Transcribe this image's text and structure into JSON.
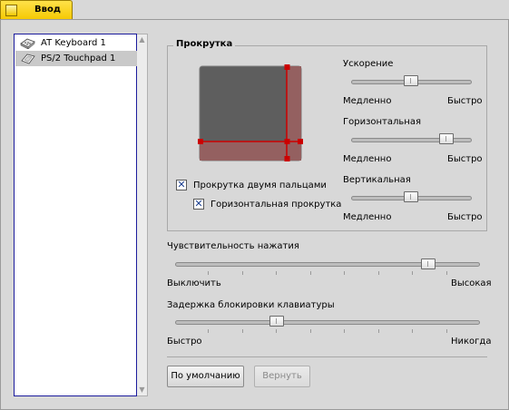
{
  "window": {
    "title": "Ввод"
  },
  "devices": [
    {
      "label": "AT Keyboard 1",
      "icon": "keyboard-icon",
      "selected": false
    },
    {
      "label": "PS/2 Touchpad 1",
      "icon": "touchpad-icon",
      "selected": true
    }
  ],
  "scroll_section": {
    "legend": "Прокрутка",
    "two_finger_label": "Прокрутка двумя пальцами",
    "two_finger_checked": true,
    "horizontal_scroll_label": "Горизонтальная прокрутка",
    "horizontal_scroll_checked": true,
    "acceleration": {
      "label": "Ускорение",
      "min_label": "Медленно",
      "max_label": "Быстро",
      "value_fraction": 0.5
    },
    "horizontal": {
      "label": "Горизонтальная",
      "min_label": "Медленно",
      "max_label": "Быстро",
      "value_fraction": 0.8
    },
    "vertical": {
      "label": "Вертикальная",
      "min_label": "Медленно",
      "max_label": "Быстро",
      "value_fraction": 0.5
    }
  },
  "sensitivity": {
    "label": "Чувствительность нажатия",
    "min_label": "Выключить",
    "max_label": "Высокая",
    "value_fraction": 0.83
  },
  "keyboard_lock_delay": {
    "label": "Задержка блокировки клавиатуры",
    "min_label": "Быстро",
    "max_label": "Никогда",
    "value_fraction": 0.33
  },
  "buttons": {
    "defaults_label": "По умолчанию",
    "revert_label": "Вернуть"
  },
  "colors": {
    "title_tab": "#f5c800",
    "list_border": "#1c1c9c",
    "scroll_area_bg": "#5e5e5e",
    "scroll_strip_bg": "#946060",
    "scroll_handle": "#cc0000"
  }
}
